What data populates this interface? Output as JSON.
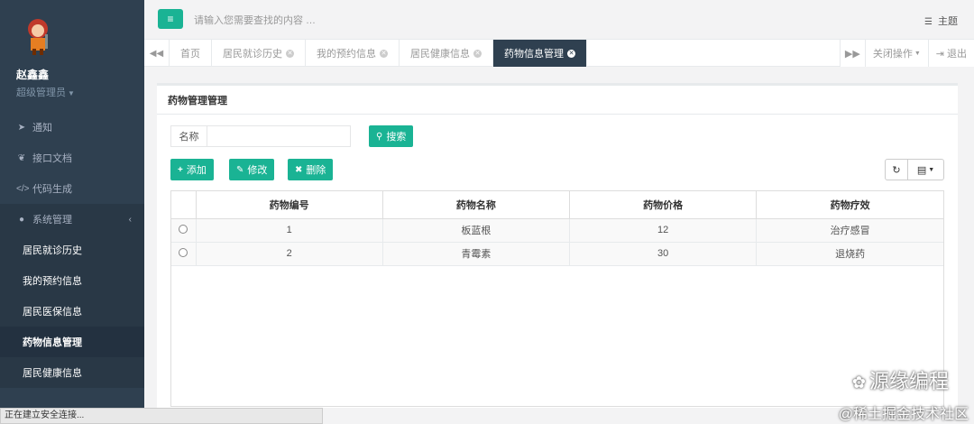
{
  "profile": {
    "name": "赵鑫鑫",
    "role": "超级管理员"
  },
  "sidebar": {
    "items": [
      {
        "label": "通知",
        "icon": "send-icon"
      },
      {
        "label": "接口文档",
        "icon": "leaf-icon"
      },
      {
        "label": "代码生成",
        "icon": "code-icon"
      },
      {
        "label": "系统管理",
        "icon": "user-icon"
      }
    ],
    "sub_items": [
      {
        "label": "居民就诊历史"
      },
      {
        "label": "我的预约信息"
      },
      {
        "label": "居民医保信息"
      },
      {
        "label": "药物信息管理"
      },
      {
        "label": "居民健康信息"
      }
    ]
  },
  "header": {
    "search_placeholder": "请输入您需要查找的内容 …",
    "theme_label": "主题"
  },
  "tabs": [
    {
      "label": "首页"
    },
    {
      "label": "居民就诊历史"
    },
    {
      "label": "我的预约信息"
    },
    {
      "label": "居民健康信息"
    },
    {
      "label": "药物信息管理"
    }
  ],
  "tab_actions": {
    "close_ops": "关闭操作",
    "logout": "退出"
  },
  "panel": {
    "title": "药物管理管理"
  },
  "search_form": {
    "name_label": "名称",
    "name_value": "",
    "search_button": "搜索"
  },
  "toolbar": {
    "add": "添加",
    "edit": "修改",
    "delete": "删除"
  },
  "table": {
    "columns": [
      "药物编号",
      "药物名称",
      "药物价格",
      "药物疗效"
    ],
    "rows": [
      [
        "1",
        "板蓝根",
        "12",
        "治疗感冒"
      ],
      [
        "2",
        "青霉素",
        "30",
        "退烧药"
      ]
    ]
  },
  "status_bar": "正在建立安全连接...",
  "watermark": {
    "line1": "源缘编程",
    "line2": "@稀土掘金技术社区"
  },
  "colors": {
    "accent": "#1ab394",
    "sidebar": "#2f4050"
  }
}
